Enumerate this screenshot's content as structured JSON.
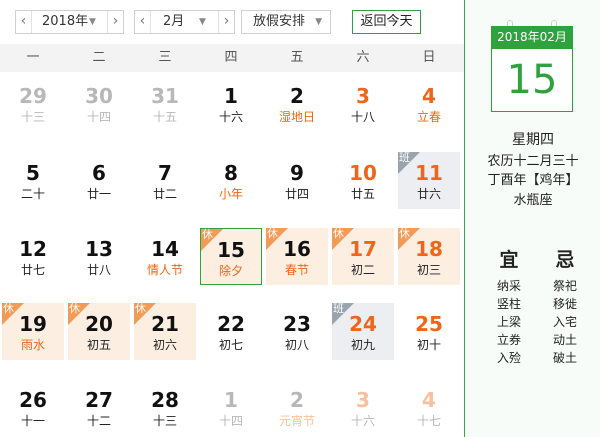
{
  "toolbar": {
    "year": "2018年",
    "month": "2月",
    "holiday_label": "放假安排",
    "today_label": "返回今天"
  },
  "weekdays": [
    "一",
    "二",
    "三",
    "四",
    "五",
    "六",
    "日"
  ],
  "weeks": [
    [
      {
        "solar": "29",
        "lunar": "十三",
        "other": true
      },
      {
        "solar": "30",
        "lunar": "十四",
        "other": true
      },
      {
        "solar": "31",
        "lunar": "十五",
        "other": true
      },
      {
        "solar": "1",
        "lunar": "十六"
      },
      {
        "solar": "2",
        "lunar": "湿地日",
        "fest": true
      },
      {
        "solar": "3",
        "lunar": "十八",
        "wknd": true
      },
      {
        "solar": "4",
        "lunar": "立春",
        "wknd": true,
        "fest": true
      }
    ],
    [
      {
        "solar": "5",
        "lunar": "二十"
      },
      {
        "solar": "6",
        "lunar": "廿一"
      },
      {
        "solar": "7",
        "lunar": "廿二"
      },
      {
        "solar": "8",
        "lunar": "小年",
        "fest": true
      },
      {
        "solar": "9",
        "lunar": "廿四"
      },
      {
        "solar": "10",
        "lunar": "廿五",
        "wknd": true
      },
      {
        "solar": "11",
        "lunar": "廿六",
        "wknd": true,
        "status": "work"
      }
    ],
    [
      {
        "solar": "12",
        "lunar": "廿七"
      },
      {
        "solar": "13",
        "lunar": "廿八"
      },
      {
        "solar": "14",
        "lunar": "情人节",
        "fest": true
      },
      {
        "solar": "15",
        "lunar": "除夕",
        "fest": true,
        "status": "rest",
        "today": true
      },
      {
        "solar": "16",
        "lunar": "春节",
        "fest": true,
        "status": "rest"
      },
      {
        "solar": "17",
        "lunar": "初二",
        "wknd": true,
        "status": "rest"
      },
      {
        "solar": "18",
        "lunar": "初三",
        "wknd": true,
        "status": "rest"
      }
    ],
    [
      {
        "solar": "19",
        "lunar": "雨水",
        "fest": true,
        "status": "rest"
      },
      {
        "solar": "20",
        "lunar": "初五",
        "status": "rest"
      },
      {
        "solar": "21",
        "lunar": "初六",
        "status": "rest"
      },
      {
        "solar": "22",
        "lunar": "初七"
      },
      {
        "solar": "23",
        "lunar": "初八"
      },
      {
        "solar": "24",
        "lunar": "初九",
        "wknd": true,
        "status": "work"
      },
      {
        "solar": "25",
        "lunar": "初十",
        "wknd": true
      }
    ],
    [
      {
        "solar": "26",
        "lunar": "十一"
      },
      {
        "solar": "27",
        "lunar": "十二"
      },
      {
        "solar": "28",
        "lunar": "十三"
      },
      {
        "solar": "1",
        "lunar": "十四",
        "other": true
      },
      {
        "solar": "2",
        "lunar": "元宵节",
        "other": true,
        "fest": true
      },
      {
        "solar": "3",
        "lunar": "十六",
        "other": true,
        "wknd": true
      },
      {
        "solar": "4",
        "lunar": "十七",
        "other": true,
        "wknd": true
      }
    ]
  ],
  "status_tags": {
    "rest": "休",
    "work": "班"
  },
  "detail": {
    "header": "2018年02月",
    "day": "15",
    "weekday": "星期四",
    "lunar": "农历十二月三十",
    "ganzhi": "丁酉年【鸡年】",
    "constellation": "水瓶座"
  },
  "yi": {
    "title": "宜",
    "items": [
      "纳采",
      "竖柱",
      "上梁",
      "立券",
      "入殓"
    ]
  },
  "ji": {
    "title": "忌",
    "items": [
      "祭祀",
      "移徙",
      "入宅",
      "动土",
      "破土"
    ]
  },
  "colors": {
    "accent": "#2fa23e",
    "festival": "#f06519",
    "rest_bg": "#fdeee2",
    "work_bg": "#eceef1"
  }
}
